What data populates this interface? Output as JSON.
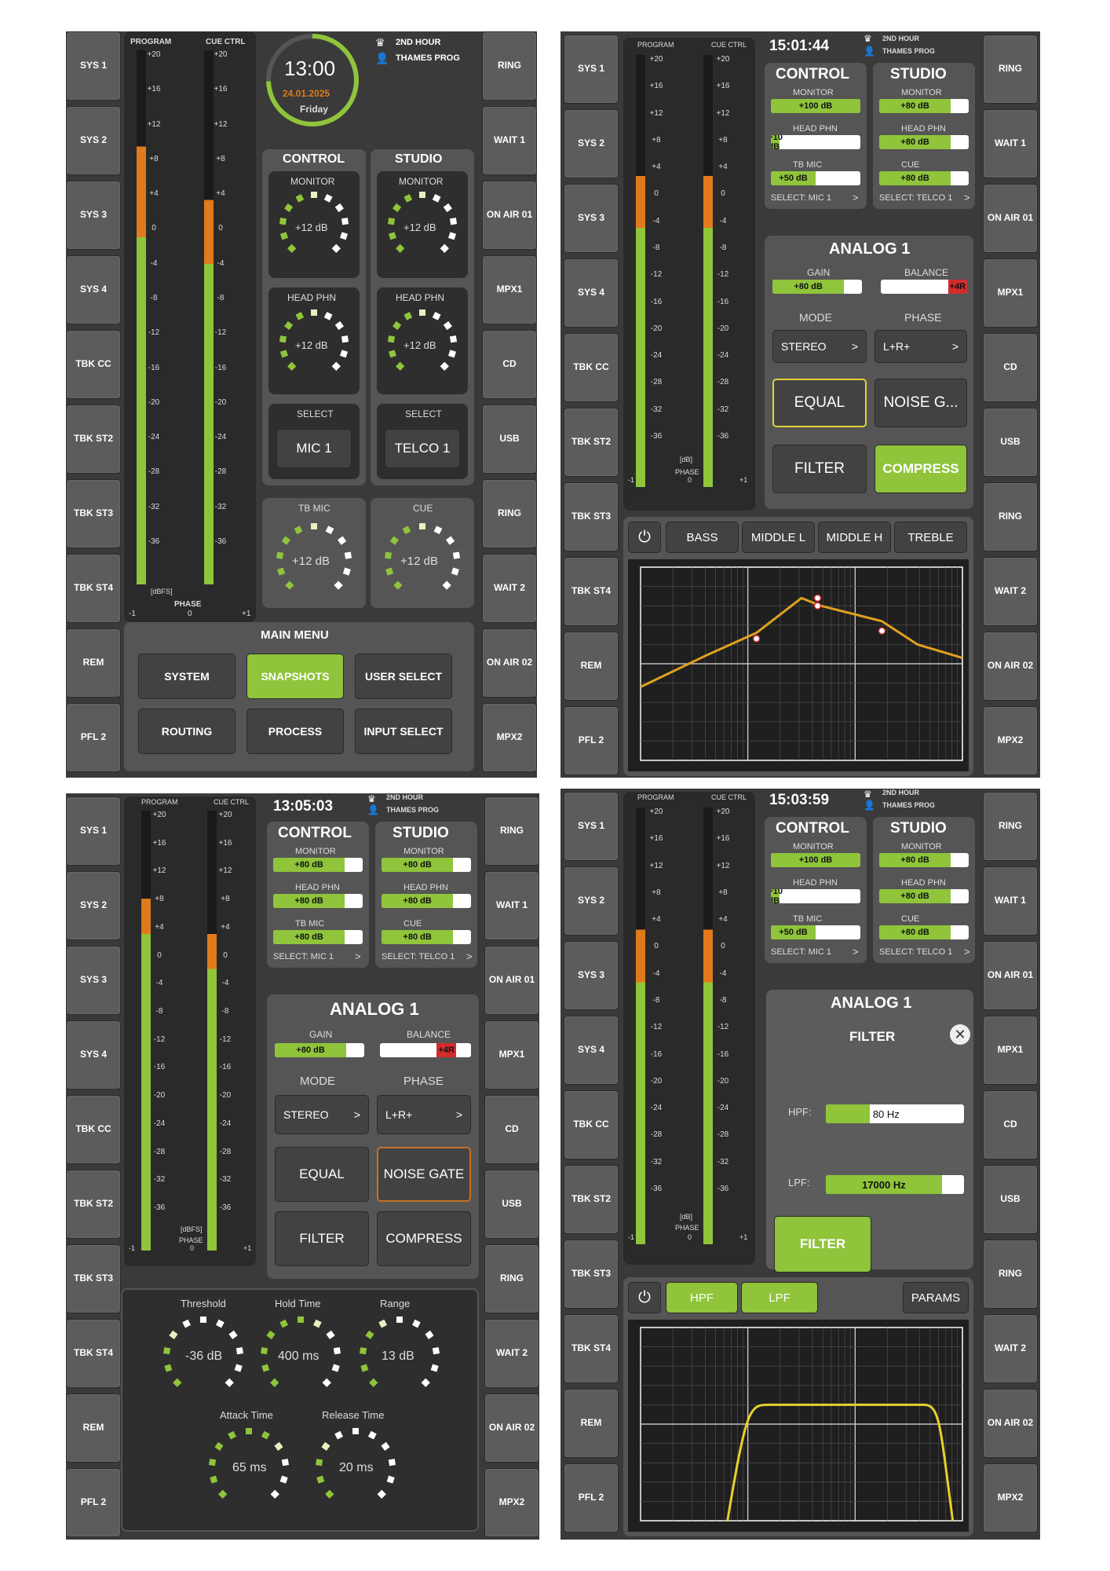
{
  "left_column": [
    "SYS 1",
    "SYS 2",
    "SYS 3",
    "SYS 4",
    "TBK CC",
    "TBK ST2",
    "TBK ST3",
    "TBK ST4",
    "REM",
    "PFL 2"
  ],
  "right_column": [
    "RING",
    "WAIT 1",
    "ON AIR 01",
    "MPX1",
    "CD",
    "USB",
    "RING",
    "WAIT 2",
    "ON AIR 02",
    "MPX2"
  ],
  "meter": {
    "program": "PROGRAM",
    "cue": "CUE CTRL",
    "scale": [
      "+20",
      "+16",
      "+12",
      "+8",
      "+4",
      "0",
      "-4",
      "-8",
      "-12",
      "-16",
      "-20",
      "-24",
      "-28",
      "-32",
      "-36"
    ],
    "unit": "[dBFS]",
    "unit2": "[dB]",
    "phase": "PHASE",
    "phase_min": "-1",
    "phase_mid": "0",
    "phase_max": "+1"
  },
  "info": {
    "line1": "2ND HOUR",
    "line2": "THAMES PROG"
  },
  "p1": {
    "time": "13:00",
    "date": "24.01.2025",
    "day": "Friday",
    "control": "CONTROL",
    "studio": "STUDIO",
    "monitor": "MONITOR",
    "headphn": "HEAD PHN",
    "select": "SELECT",
    "mic": "MIC 1",
    "telco": "TELCO 1",
    "knob": "+12 dB",
    "tbmic": "TB MIC",
    "cue": "CUE",
    "main_menu": "MAIN MENU",
    "menu": [
      "SYSTEM",
      "SNAPSHOTS",
      "USER SELECT",
      "ROUTING",
      "PROCESS",
      "INPUT SELECT"
    ]
  },
  "p2": {
    "time": "15:01:44",
    "control": "CONTROL",
    "studio": "STUDIO",
    "monitor": "MONITOR",
    "headphn": "HEAD PHN",
    "tbmic": "TB MIC",
    "cue": "CUE",
    "c_mon": "+100 dB",
    "c_hp": "+10 dB",
    "c_tb": "+50 dB",
    "s_mon": "+80 dB",
    "s_hp": "+80 dB",
    "s_cue": "+80 dB",
    "sel_c": "SELECT:  MIC 1",
    "sel_s": "SELECT:  TELCO 1",
    "analog": "ANALOG 1",
    "gain": "GAIN",
    "gain_v": "+80 dB",
    "balance": "BALANCE",
    "bal_v": "+4R",
    "mode": "MODE",
    "phase": "PHASE",
    "mode_v": "STEREO",
    "phase_v": "L+R+",
    "equal": "EQUAL",
    "noise": "NOISE G...",
    "filter": "FILTER",
    "compress": "COMPRESS",
    "tabs": [
      "BASS",
      "MIDDLE L",
      "MIDDLE H",
      "TREBLE"
    ]
  },
  "p3": {
    "time": "13:05:03",
    "control": "CONTROL",
    "studio": "STUDIO",
    "monitor": "MONITOR",
    "headphn": "HEAD PHN",
    "tbmic": "TB MIC",
    "cue": "CUE",
    "v": "+80 dB",
    "sel_c": "SELECT:  MIC 1",
    "sel_s": "SELECT:  TELCO 1",
    "analog": "ANALOG 1",
    "gain": "GAIN",
    "gain_v": "+80 dB",
    "balance": "BALANCE",
    "bal_v": "+4R",
    "mode": "MODE",
    "phase": "PHASE",
    "mode_v": "STEREO",
    "phase_v": "L+R+",
    "equal": "EQUAL",
    "noise": "NOISE GATE",
    "filter": "FILTER",
    "compress": "COMPRESS",
    "threshold": "Threshold",
    "threshold_v": "-36 dB",
    "hold": "Hold Time",
    "hold_v": "400 ms",
    "range": "Range",
    "range_v": "13 dB",
    "attack": "Attack Time",
    "attack_v": "65 ms",
    "release": "Release Time",
    "release_v": "20 ms"
  },
  "p4": {
    "time": "15:03:59",
    "control": "CONTROL",
    "studio": "STUDIO",
    "monitor": "MONITOR",
    "headphn": "HEAD PHN",
    "tbmic": "TB MIC",
    "cue": "CUE",
    "c_mon": "+100 dB",
    "c_hp": "+10 dB",
    "c_tb": "+50 dB",
    "s_mon": "+80 dB",
    "s_hp": "+80 dB",
    "s_cue": "+80 dB",
    "sel_c": "SELECT:  MIC 1",
    "sel_s": "SELECT:  TELCO 1",
    "analog": "ANALOG 1",
    "filter_title": "FILTER",
    "hpf": "HPF:",
    "hpf_v": "80 Hz",
    "lpf": "LPF:",
    "lpf_v": "17000 Hz",
    "filter_btn": "FILTER",
    "hpf_tab": "HPF",
    "lpf_tab": "LPF",
    "params": "PARAMS"
  }
}
